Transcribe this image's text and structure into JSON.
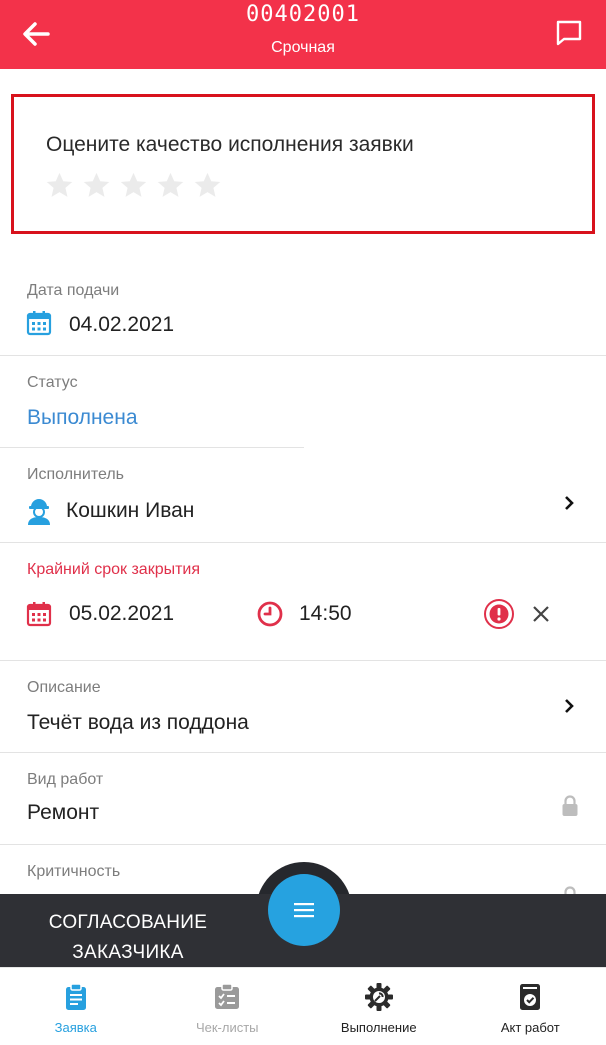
{
  "header": {
    "title": "00402001",
    "subtitle": "Срочная"
  },
  "rating": {
    "prompt": "Оцените качество исполнения заявки",
    "stars_total": 5,
    "stars_filled": 0
  },
  "fields": {
    "date": {
      "label": "Дата подачи",
      "value": "04.02.2021"
    },
    "status": {
      "label": "Статус",
      "value": "Выполнена"
    },
    "executor": {
      "label": "Исполнитель",
      "value": "Кошкин Иван"
    },
    "deadline": {
      "label": "Крайний срок закрытия",
      "date": "05.02.2021",
      "time": "14:50"
    },
    "description": {
      "label": "Описание",
      "value": "Течёт вода из поддона"
    },
    "work_type": {
      "label": "Вид работ",
      "value": "Ремонт"
    },
    "criticality": {
      "label": "Критичность"
    }
  },
  "bottom_action": {
    "line1": "СОГЛАСОВАНИЕ",
    "line2": "ЗАКАЗЧИКА"
  },
  "tabs": [
    {
      "label": "Заявка",
      "icon": "clipboard-icon",
      "active": true
    },
    {
      "label": "Чек-листы",
      "icon": "checklist-icon",
      "active": false
    },
    {
      "label": "Выполнение",
      "icon": "gear-wrench-icon",
      "active": false
    },
    {
      "label": "Акт работ",
      "icon": "act-document-icon",
      "active": false
    }
  ],
  "colors": {
    "header": "#f3324a",
    "accent": "#26a2e0",
    "status": "#3b8ad2",
    "deadline": "#e0304a",
    "rating_border": "#d8121c"
  }
}
